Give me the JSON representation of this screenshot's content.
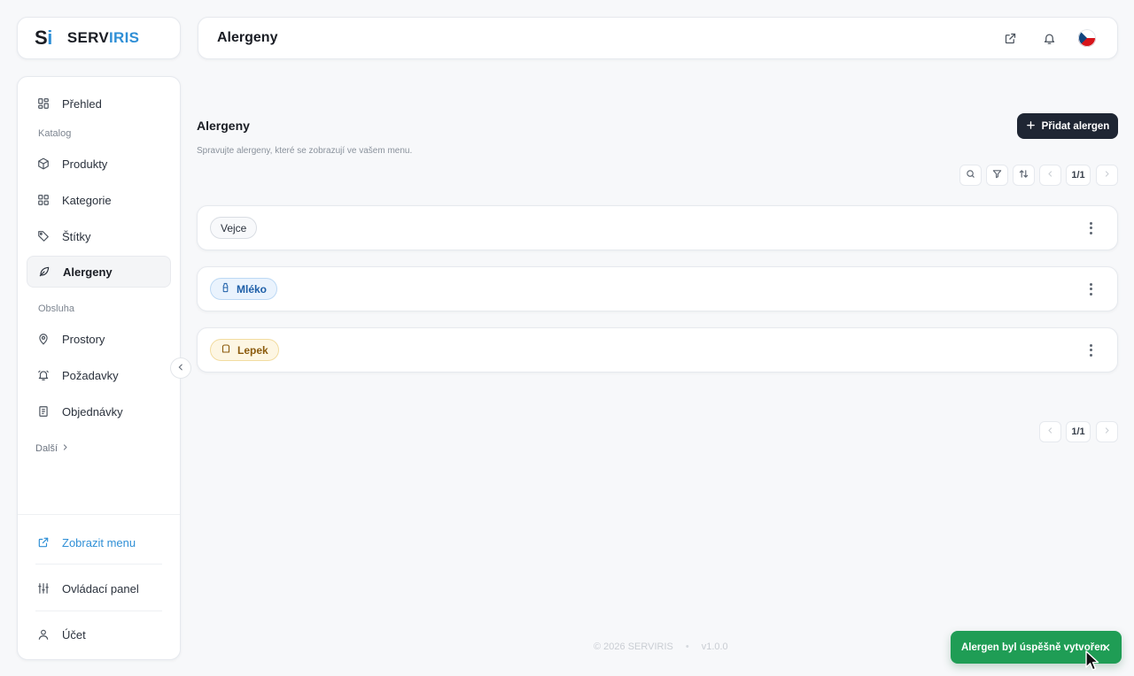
{
  "app": {
    "logo_mark": "S",
    "logo_mark_i": "i",
    "logo_name_1": "SERV",
    "logo_name_2": "IRIS"
  },
  "header": {
    "title": "Alergeny",
    "icons": [
      "external-link-icon",
      "bell-icon",
      "czech-flag-icon"
    ]
  },
  "sidebar": {
    "items": [
      {
        "label": "Přehled",
        "icon": "dashboard-icon"
      },
      {
        "label": "Produkty",
        "icon": "box-icon"
      },
      {
        "label": "Kategorie",
        "icon": "grid-icon"
      },
      {
        "label": "Štítky",
        "icon": "tag-icon"
      },
      {
        "label": "Alergeny",
        "icon": "leaf-icon",
        "active": true
      },
      {
        "label": "Prostory",
        "icon": "map-pin-icon"
      },
      {
        "label": "Požadavky",
        "icon": "bell-ring-icon"
      },
      {
        "label": "Objednávky",
        "icon": "receipt-icon"
      }
    ],
    "section_catalog": "Katalog",
    "section_service": "Obsluha",
    "more": "Další",
    "bottom": {
      "view_menu": "Zobrazit menu",
      "control_panel": "Ovládací panel",
      "account": "Účet"
    }
  },
  "main": {
    "title": "Alergeny",
    "subtitle": "Spravujte alergeny, které se zobrazují ve vašem menu.",
    "add_button": "Přidat alergen",
    "pager_top": "1/1",
    "pager_bottom": "1/1",
    "allergens": [
      {
        "name": "Vejce",
        "style": "gray",
        "icon": ""
      },
      {
        "name": "Mléko",
        "style": "blue",
        "icon": "milk-bottle-icon"
      },
      {
        "name": "Lepek",
        "style": "amber",
        "icon": "bread-icon"
      }
    ]
  },
  "footer": {
    "copyright": "© 2026 SERVIRIS",
    "separator": "•",
    "version": "v1.0.0"
  },
  "toast": {
    "message": "Alergen byl úspěšně vytvořen",
    "close": "✕"
  },
  "colors": {
    "accent": "#2f8fd6",
    "primary_button": "#1f2633",
    "toast_success": "#1f9d55"
  }
}
